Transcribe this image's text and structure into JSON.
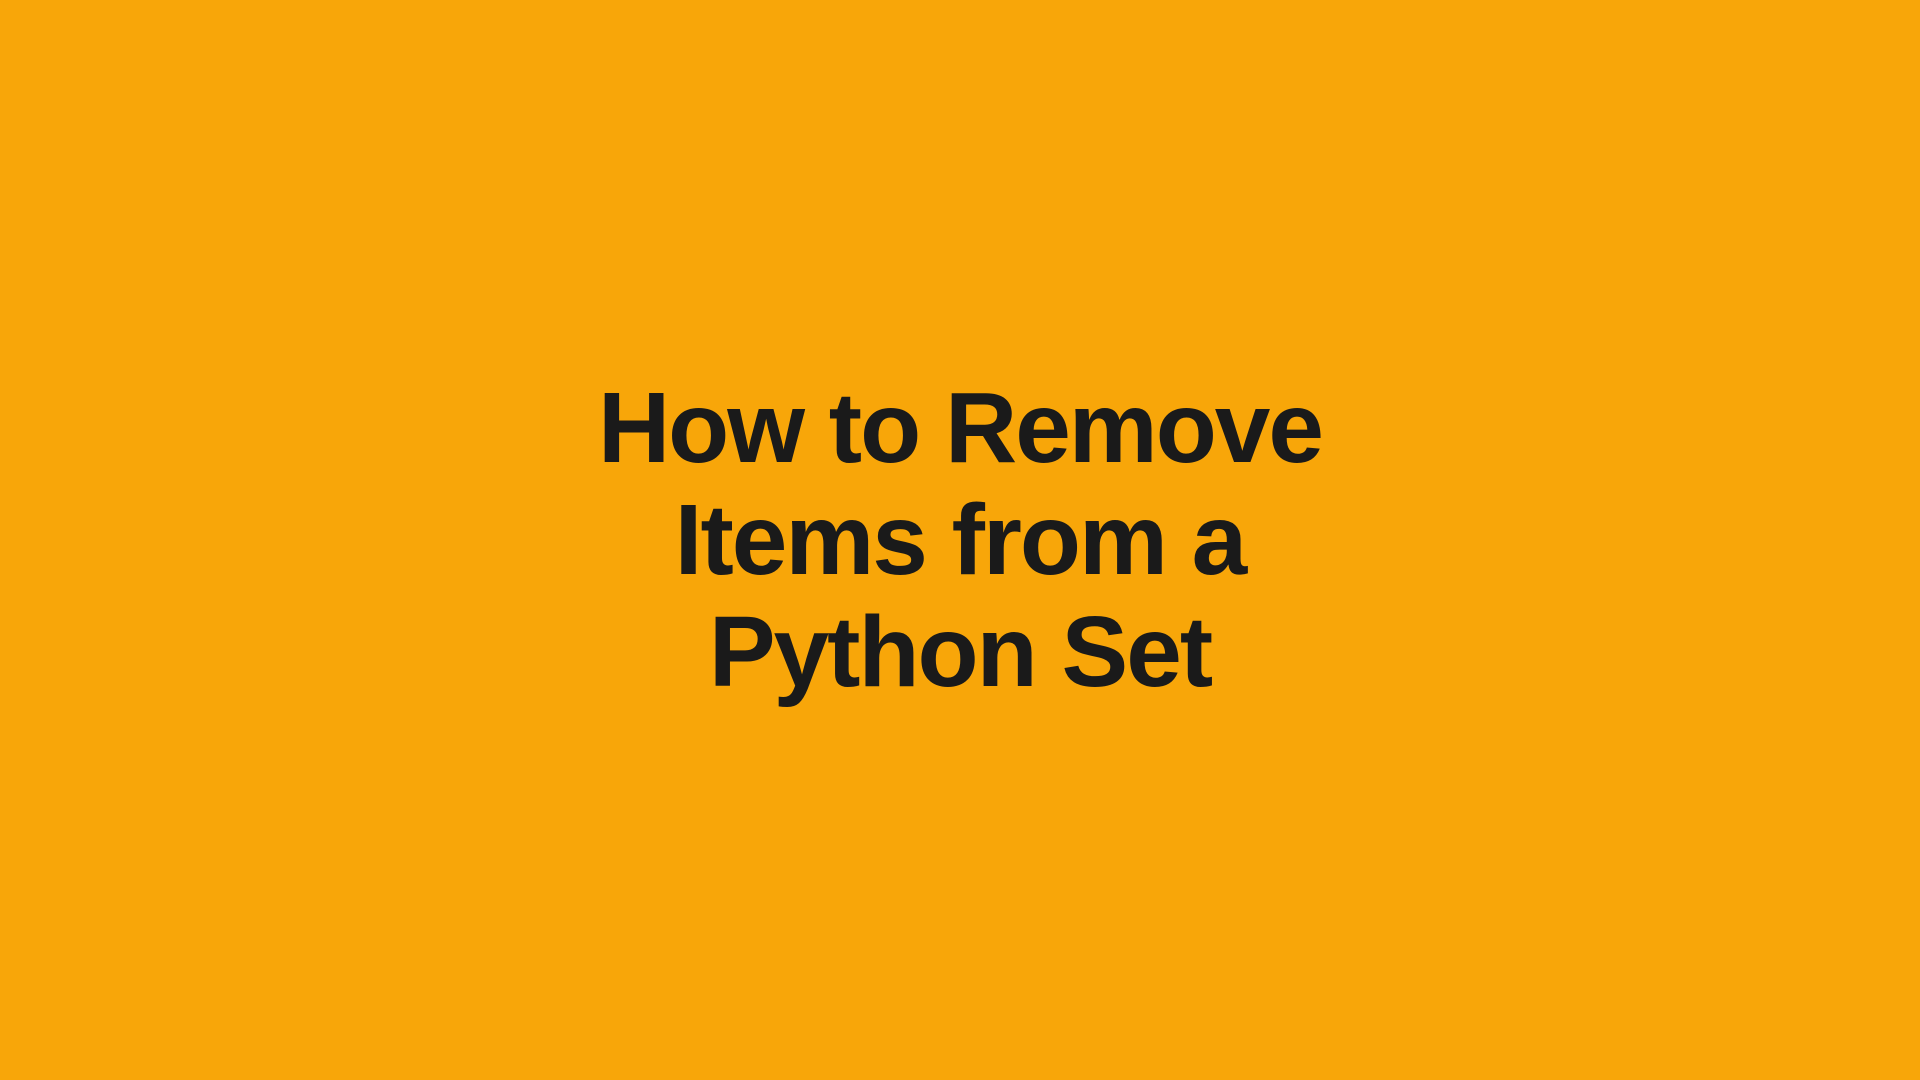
{
  "title": {
    "line1": "How to Remove",
    "line2": "Items from a",
    "line3": "Python Set"
  }
}
